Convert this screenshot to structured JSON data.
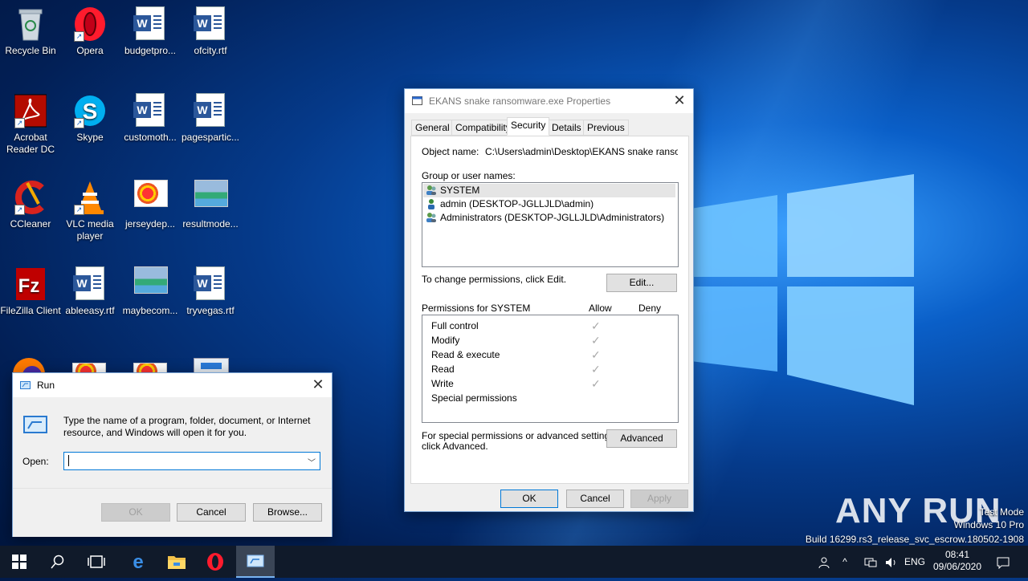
{
  "desktop": {
    "icons": [
      {
        "label": "Recycle Bin",
        "icon": "recycle-bin-icon"
      },
      {
        "label": "Opera",
        "icon": "opera-icon"
      },
      {
        "label": "budgetpro...",
        "icon": "word-doc-icon"
      },
      {
        "label": "ofcity.rtf",
        "icon": "word-doc-icon"
      },
      {
        "label": "Acrobat Reader DC",
        "icon": "acrobat-icon"
      },
      {
        "label": "Skype",
        "icon": "skype-icon"
      },
      {
        "label": "customoth...",
        "icon": "word-doc-icon"
      },
      {
        "label": "pagespartic...",
        "icon": "word-doc-icon"
      },
      {
        "label": "CCleaner",
        "icon": "ccleaner-icon"
      },
      {
        "label": "VLC media player",
        "icon": "vlc-icon"
      },
      {
        "label": "jerseydep...",
        "icon": "image-file-icon"
      },
      {
        "label": "resultmode...",
        "icon": "image-file-icon"
      },
      {
        "label": "FileZilla Client",
        "icon": "filezilla-icon"
      },
      {
        "label": "ableeasy.rtf",
        "icon": "word-doc-icon"
      },
      {
        "label": "maybecom...",
        "icon": "image-file-icon"
      },
      {
        "label": "tryvegas.rtf",
        "icon": "word-doc-icon"
      }
    ]
  },
  "properties": {
    "title": "EKANS snake ransomware.exe Properties",
    "tabs": [
      "General",
      "Compatibility",
      "Security",
      "Details",
      "Previous Versions"
    ],
    "active_tab": "Security",
    "object_name_label": "Object name:",
    "object_name_value": "C:\\Users\\admin\\Desktop\\EKANS snake ransomwa",
    "group_label": "Group or user names:",
    "groups": [
      {
        "name": "SYSTEM",
        "icon": "users-group-icon"
      },
      {
        "name": "admin (DESKTOP-JGLLJLD\\admin)",
        "icon": "user-icon"
      },
      {
        "name": "Administrators (DESKTOP-JGLLJLD\\Administrators)",
        "icon": "users-group-icon"
      }
    ],
    "change_hint": "To change permissions, click Edit.",
    "edit_button": "Edit...",
    "permissions_label": "Permissions for SYSTEM",
    "allow_label": "Allow",
    "deny_label": "Deny",
    "permissions": [
      {
        "name": "Full control",
        "allow": true,
        "deny": false
      },
      {
        "name": "Modify",
        "allow": true,
        "deny": false
      },
      {
        "name": "Read & execute",
        "allow": true,
        "deny": false
      },
      {
        "name": "Read",
        "allow": true,
        "deny": false
      },
      {
        "name": "Write",
        "allow": true,
        "deny": false
      },
      {
        "name": "Special permissions",
        "allow": false,
        "deny": false
      }
    ],
    "special_hint_1": "For special permissions or advanced settings,",
    "special_hint_2": "click Advanced.",
    "advanced_button": "Advanced",
    "ok_button": "OK",
    "cancel_button": "Cancel",
    "apply_button": "Apply"
  },
  "run": {
    "title": "Run",
    "description_1": "Type the name of a program, folder, document, or Internet",
    "description_2": "resource, and Windows will open it for you.",
    "open_label": "Open:",
    "input_value": "",
    "ok_button": "OK",
    "cancel_button": "Cancel",
    "browse_button": "Browse..."
  },
  "taskbar": {
    "items": [
      "start-icon",
      "search-icon",
      "task-view-icon",
      "edge-icon",
      "file-explorer-icon",
      "opera-icon",
      "run-icon"
    ],
    "language": "ENG",
    "time": "08:41",
    "date": "09/06/2020"
  },
  "watermark": {
    "brand": "ANY RUN",
    "line1": "Test Mode",
    "line2": "Windows 10 Pro",
    "line3": "Build 16299.rs3_release_svc_escrow.180502-1908"
  },
  "colors": {
    "accent": "#0078d7",
    "desktop_blue": "#0a5fc8",
    "taskbar": "#101a2a"
  }
}
